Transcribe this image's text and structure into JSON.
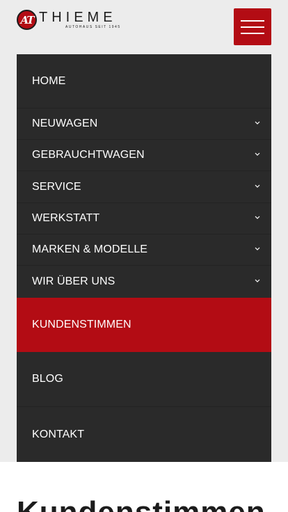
{
  "header": {
    "logo_mark": "AT",
    "logo_text": "THIEME",
    "logo_tagline": "AUTOHAUS SEIT 1945",
    "menu_button_icon": "hamburger-icon",
    "accent_color": "#b30c14"
  },
  "nav": {
    "items": [
      {
        "label": "HOME",
        "has_submenu": false,
        "active": false
      },
      {
        "label": "NEUWAGEN",
        "has_submenu": true,
        "active": false
      },
      {
        "label": "GEBRAUCHTWAGEN",
        "has_submenu": true,
        "active": false
      },
      {
        "label": "SERVICE",
        "has_submenu": true,
        "active": false
      },
      {
        "label": "WERKSTATT",
        "has_submenu": true,
        "active": false
      },
      {
        "label": "MARKEN & MODELLE",
        "has_submenu": true,
        "active": false
      },
      {
        "label": "WIR ÜBER UNS",
        "has_submenu": true,
        "active": false
      },
      {
        "label": "KUNDENSTIMMEN",
        "has_submenu": false,
        "active": true
      },
      {
        "label": "BLOG",
        "has_submenu": false,
        "active": false
      },
      {
        "label": "KONTAKT",
        "has_submenu": false,
        "active": false
      }
    ],
    "submenu_icon": "chevron-down-icon"
  },
  "main": {
    "title": "Kundenstimmen"
  }
}
